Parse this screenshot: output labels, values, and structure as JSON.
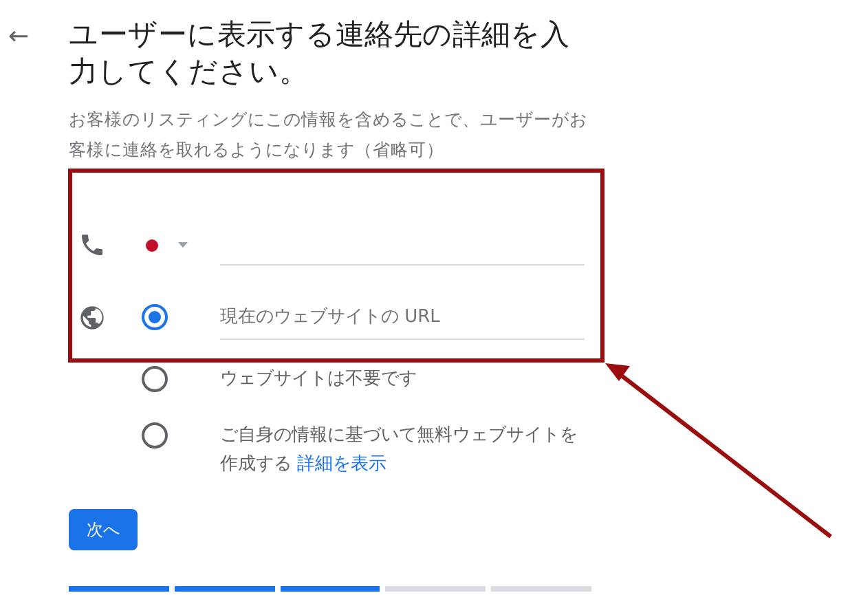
{
  "back_button": {
    "label": "←"
  },
  "title": "ユーザーに表示する連絡先の詳細を入力してください。",
  "subtitle": "お客様のリスティングにこの情報を含めることで、ユーザーがお客様に連絡を取れるようになります（省略可）",
  "website_options": [
    {
      "kind": "field",
      "placeholder": "現在のウェブサイトの URL",
      "selected": true
    },
    {
      "kind": "text",
      "label": "ウェブサイトは不要です",
      "selected": false
    },
    {
      "kind": "text",
      "label": "ご自身の情報に基づいて無料ウェブサイトを作成する",
      "link": "詳細を表示",
      "selected": false
    }
  ],
  "next_button": {
    "label": "次へ"
  },
  "progress_steps": [
    {
      "done": true
    },
    {
      "done": true
    },
    {
      "done": true
    },
    {
      "done": false
    },
    {
      "done": false
    }
  ]
}
